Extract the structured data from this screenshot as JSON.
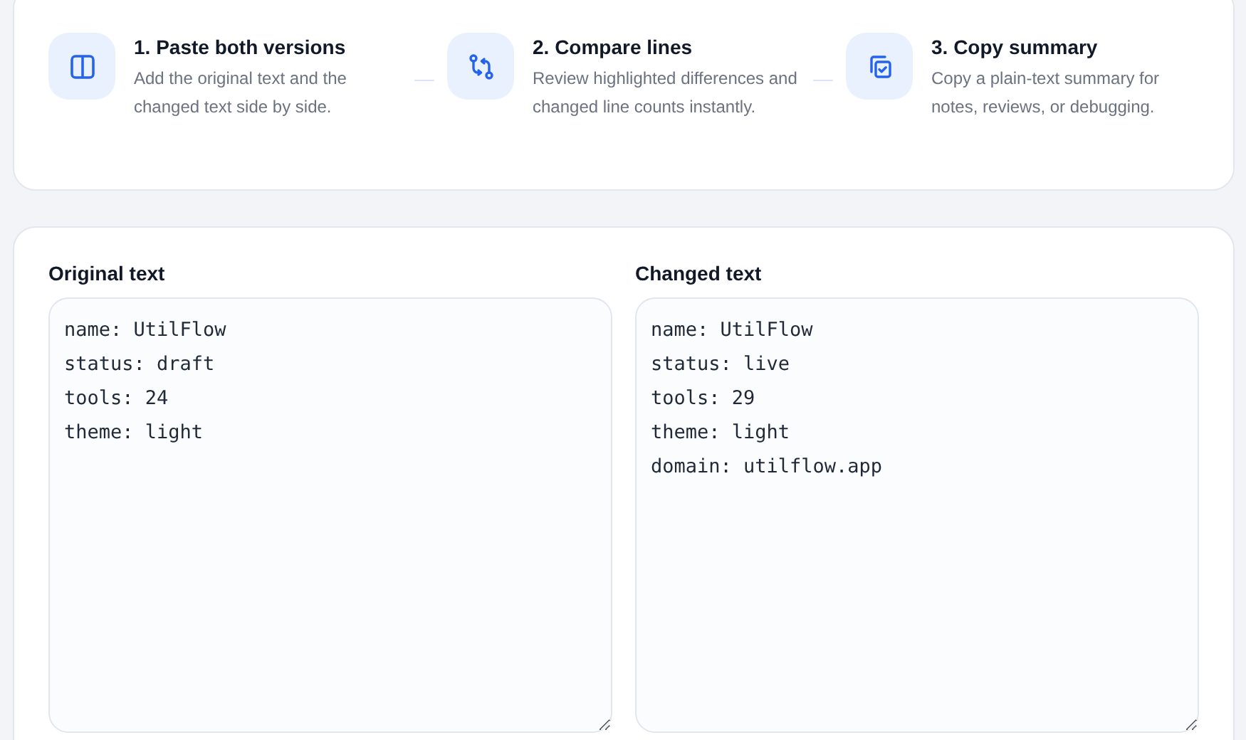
{
  "steps": [
    {
      "kind": "columns",
      "title": "1. Paste both versions",
      "description": "Add the original text and the changed text side by side."
    },
    {
      "kind": "compare",
      "title": "2. Compare lines",
      "description": "Review highlighted differences and changed line counts instantly."
    },
    {
      "kind": "copy",
      "title": "3. Copy summary",
      "description": "Copy a plain-text summary for notes, reviews, or debugging."
    }
  ],
  "editors": [
    {
      "label": "Original text",
      "lines": [
        "name: UtilFlow",
        "status: draft",
        "tools: 24",
        "theme: light"
      ]
    },
    {
      "label": "Changed text",
      "lines": [
        "name: UtilFlow",
        "status: live",
        "tools: 29",
        "theme: light",
        "domain: utilflow.app"
      ]
    }
  ]
}
